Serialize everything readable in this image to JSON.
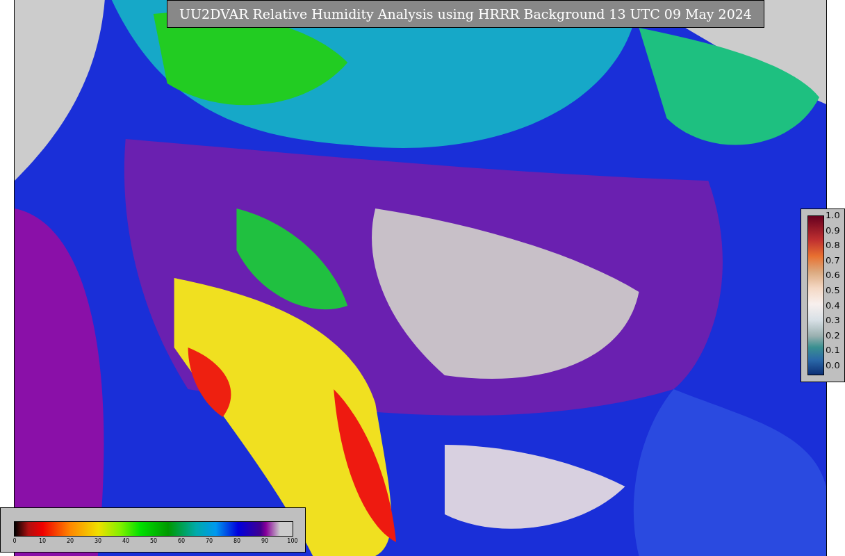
{
  "title": "UU2DVAR Relative Humidity Analysis using HRRR Background 13 UTC 09 May 2024",
  "humidity_colorbar": {
    "ticks": [
      "0",
      "10",
      "20",
      "30",
      "40",
      "50",
      "60",
      "70",
      "80",
      "90",
      "100"
    ]
  },
  "ratio_colorbar": {
    "ticks": [
      "1.0",
      "0.9",
      "0.8",
      "0.7",
      "0.6",
      "0.5",
      "0.4",
      "0.3",
      "0.2",
      "0.1",
      "0.0"
    ]
  }
}
